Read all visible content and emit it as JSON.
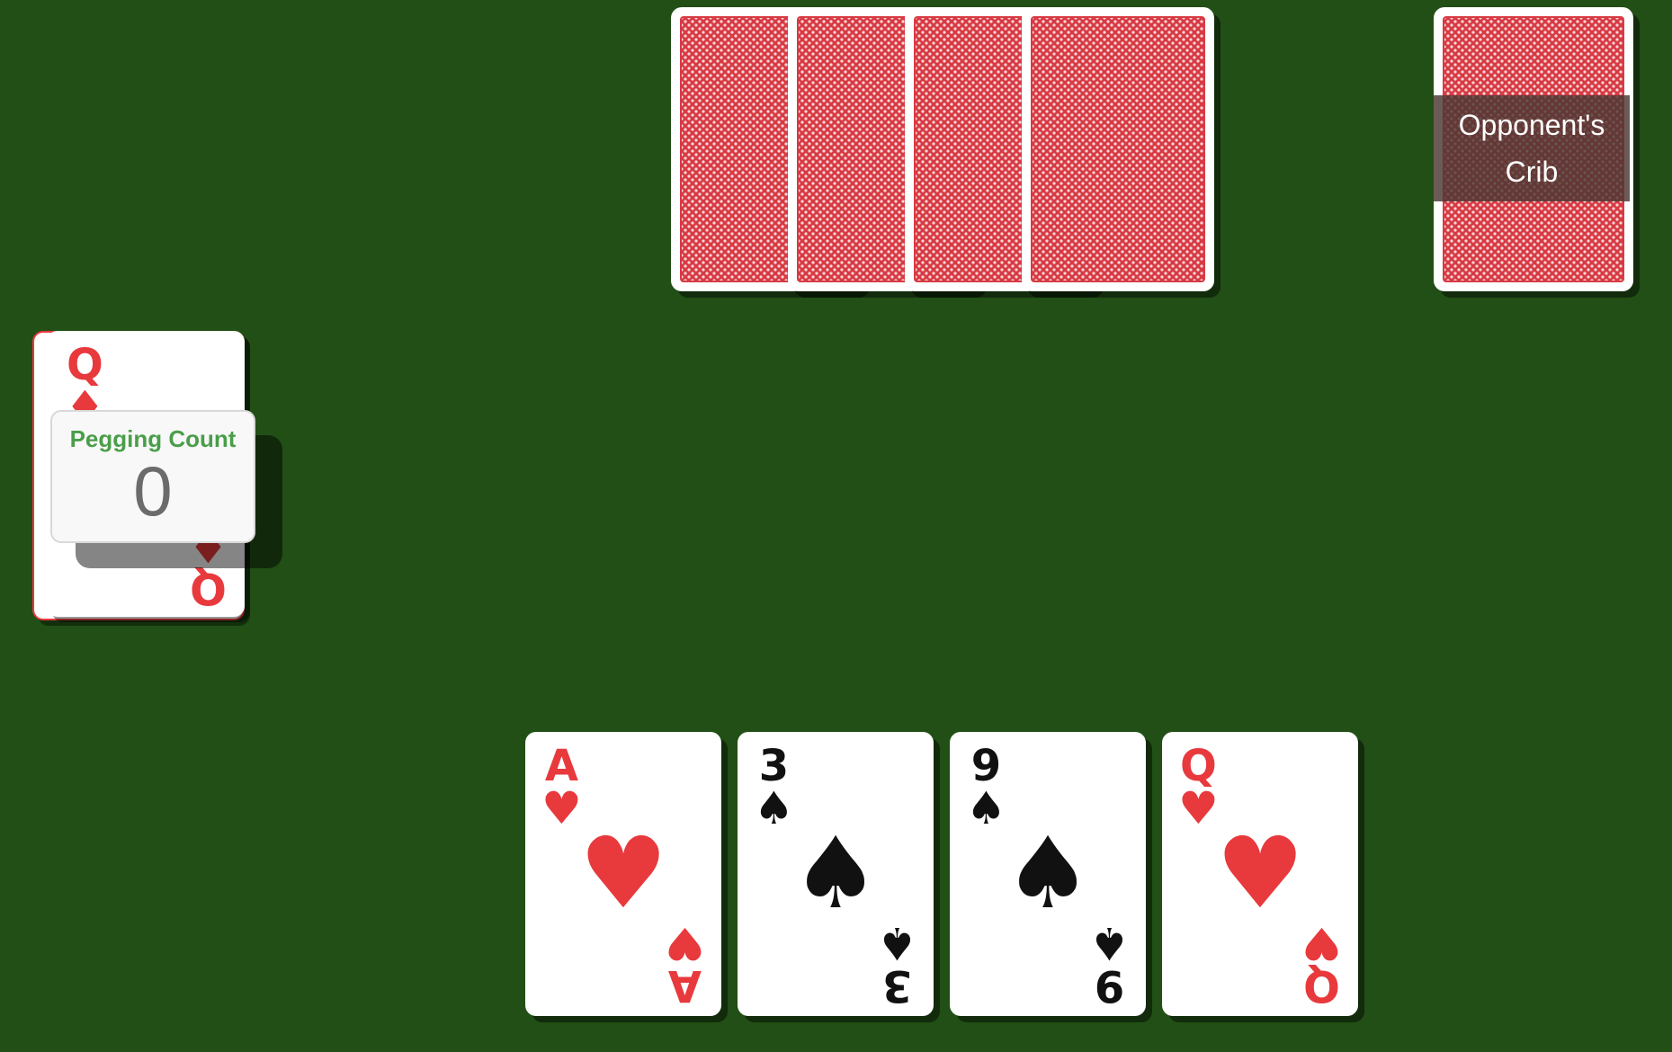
{
  "opponent_hand": {
    "card_count": 4
  },
  "crib": {
    "label_line1": "Opponent's",
    "label_line2": "Crib"
  },
  "pegging": {
    "title": "Pegging Count",
    "count": "0",
    "top_card": {
      "rank": "Q",
      "suit": "♦",
      "color": "#e8393d"
    }
  },
  "player_hand": [
    {
      "rank": "A",
      "suit": "♥",
      "color": "red"
    },
    {
      "rank": "3",
      "suit": "♠",
      "color": "black"
    },
    {
      "rank": "9",
      "suit": "♠",
      "color": "black"
    },
    {
      "rank": "Q",
      "suit": "♥",
      "color": "red"
    }
  ],
  "colors": {
    "felt": "#214f15",
    "card_back": "#d83a43",
    "red_suit": "#e8393d",
    "count_title": "#4a9e4a"
  }
}
